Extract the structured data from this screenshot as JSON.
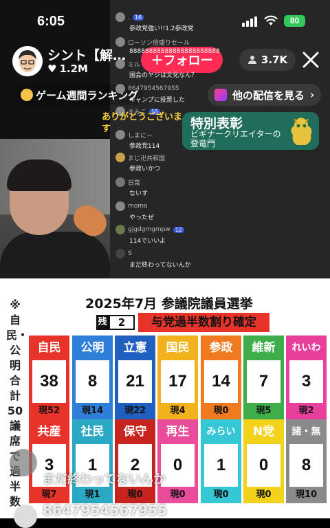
{
  "status": {
    "time": "6:05",
    "battery": "80"
  },
  "host": {
    "name": "シント【解…",
    "likes": "1.2M"
  },
  "follow_label": "＋フォロー",
  "viewers": "3.7K",
  "ranking_label": "ゲーム週間ランキング",
  "more_live_label": "他の配信を見る",
  "chat": [
    {
      "name": ".",
      "badge": "16",
      "text": "参政党強い!!1.2参政党"
    },
    {
      "name": "ローソン倍盛りセール",
      "badge": "",
      "text": "88888888888888888888888"
    },
    {
      "name": "ミル",
      "badge": "",
      "text": "国会のヤジは文化なん？"
    },
    {
      "name": "8647954567955",
      "badge": "",
      "text": "キャンプに投票した"
    },
    {
      "name": "まみこ",
      "badge": "15",
      "text": ""
    },
    {
      "name": "しまにー",
      "badge": "",
      "text": "参政党114"
    },
    {
      "name": "まじ卍共和国",
      "badge": "",
      "text": "参政いかつ"
    },
    {
      "name": "日菜",
      "badge": "",
      "text": "ないす"
    },
    {
      "name": "momo",
      "badge": "",
      "text": "やったぜ"
    },
    {
      "name": "gjgdgmgmpw",
      "badge": "12",
      "text": "114でいいよ"
    },
    {
      "name": "S",
      "badge": "",
      "text": "まだ終わってないんか"
    }
  ],
  "welcome_text": "ありがとうございます",
  "award": {
    "title": "特別表彰",
    "subtitle": "ビギナークリエイターの登竜門"
  },
  "board": {
    "title": "2025年7月 参議院議員選挙",
    "side_note": "※自民・公明合計50議席で過半数",
    "remaining_tag": "残",
    "remaining": "2",
    "headline": "与党過半数割り確定",
    "parties": [
      {
        "name": "自民",
        "seats": "38",
        "current": "現52",
        "color": "#e8332a"
      },
      {
        "name": "公明",
        "seats": "8",
        "current": "現14",
        "color": "#2f7fd8"
      },
      {
        "name": "立憲",
        "seats": "21",
        "current": "現22",
        "color": "#1f5fbf"
      },
      {
        "name": "国民",
        "seats": "17",
        "current": "現4",
        "color": "#f2b21b"
      },
      {
        "name": "参政",
        "seats": "14",
        "current": "現0",
        "color": "#f07a1f"
      },
      {
        "name": "維新",
        "seats": "7",
        "current": "現5",
        "color": "#3fae4a"
      },
      {
        "name": "れいわ",
        "seats": "3",
        "current": "現2",
        "color": "#e83f9c"
      },
      {
        "name": "共産",
        "seats": "3",
        "current": "現7",
        "color": "#e8332a"
      },
      {
        "name": "社民",
        "seats": "1",
        "current": "現1",
        "color": "#2aa8c4"
      },
      {
        "name": "保守",
        "seats": "2",
        "current": "現0",
        "color": "#c8241f"
      },
      {
        "name": "再生",
        "seats": "0",
        "current": "現0",
        "color": "#e84c9a"
      },
      {
        "name": "みらい",
        "seats": "1",
        "current": "現0",
        "color": "#36c7d6"
      },
      {
        "name": "N党",
        "seats": "0",
        "current": "現0",
        "color": "#f2d21b"
      },
      {
        "name": "諸・無",
        "seats": "8",
        "current": "現10",
        "color": "#8a8a8a"
      }
    ]
  },
  "float_comment": "まだ終わってないんか",
  "bottom_comment": "8647954567955"
}
